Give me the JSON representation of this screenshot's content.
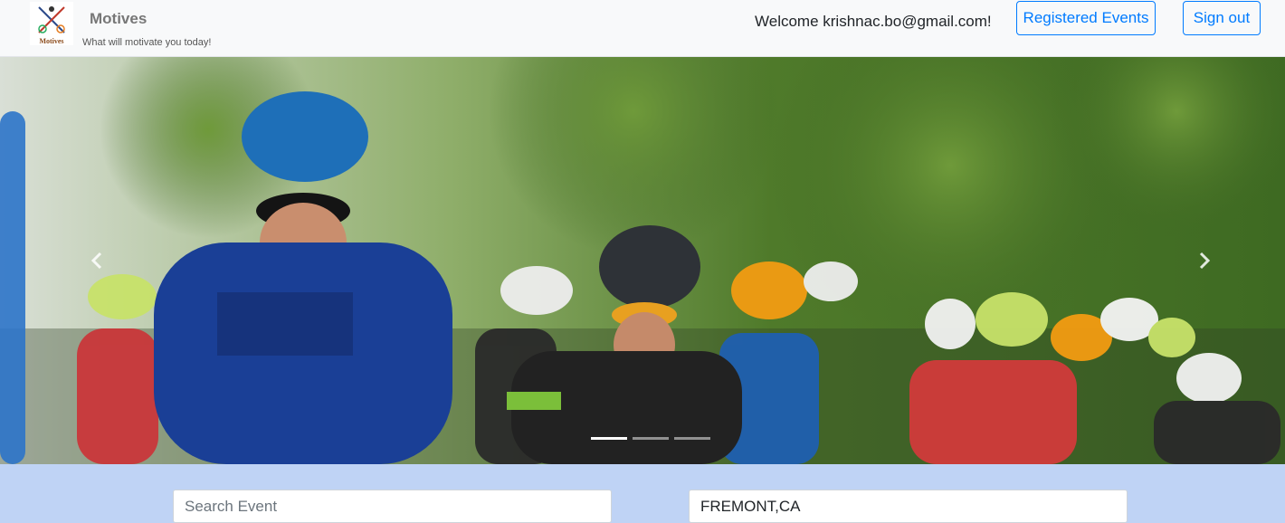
{
  "header": {
    "brand": "Motives",
    "logo_text": "Motives",
    "tagline": "What will motivate you today!",
    "welcome": "Welcome krishnac.bo@gmail.com!",
    "registered_events_label": "Registered Events",
    "sign_out_label": "Sign out"
  },
  "carousel": {
    "prev_icon": "chevron-left-icon",
    "next_icon": "chevron-right-icon",
    "slides": 3,
    "active_slide": 1
  },
  "search": {
    "event_placeholder": "Search Event",
    "event_value": "",
    "location_value": "FREMONT,CA"
  },
  "colors": {
    "accent": "#007bff",
    "search_band": "#bfd3f5",
    "navbar": "#f8f9fa"
  }
}
